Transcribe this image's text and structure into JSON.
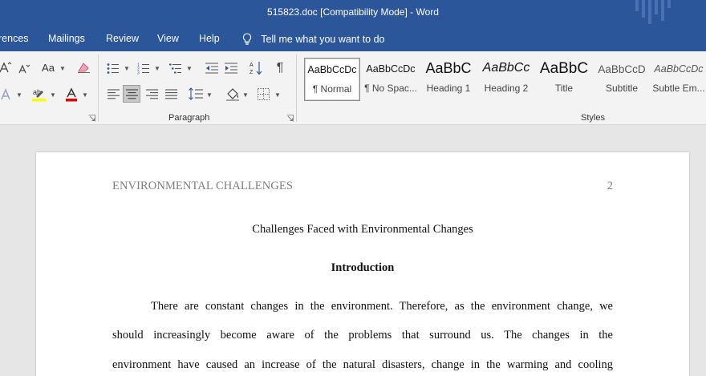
{
  "window": {
    "title": "515823.doc [Compatibility Mode]  -  Word"
  },
  "menu": {
    "items": [
      "rences",
      "Mailings",
      "Review",
      "View",
      "Help"
    ],
    "tell_me": "Tell me what you want to do"
  },
  "ribbon": {
    "font_group": {
      "case_label": "Aa"
    },
    "paragraph_group": {
      "label": "Paragraph"
    },
    "styles_group": {
      "label": "Styles",
      "items": [
        {
          "preview": "AaBbCcDc",
          "label": "¶ Normal"
        },
        {
          "preview": "AaBbCcDc",
          "label": "¶ No Spac..."
        },
        {
          "preview": "AaBbC",
          "label": "Heading 1"
        },
        {
          "preview": "AaBbCc",
          "label": "Heading 2"
        },
        {
          "preview": "AaBbC",
          "label": "Title"
        },
        {
          "preview": "AaBbCcD",
          "label": "Subtitle"
        },
        {
          "preview": "AaBbCcDc",
          "label": "Subtle Em..."
        }
      ]
    }
  },
  "document": {
    "header_left": "ENVIRONMENTAL CHALLENGES",
    "page_number": "2",
    "title": "Challenges Faced with Environmental Changes",
    "subtitle": "Introduction",
    "lines": [
      "There are constant changes in the environment. Therefore, as the environment change, we",
      "should increasingly become aware of the problems that surround us. The changes in the",
      "environment have caused an increase of the natural disasters, change in the warming and cooling"
    ]
  },
  "colors": {
    "brand": "#2b579a",
    "ribbon_bg": "#f3f3f3",
    "highlight": "#ffff00",
    "font_color": "#e00000"
  }
}
